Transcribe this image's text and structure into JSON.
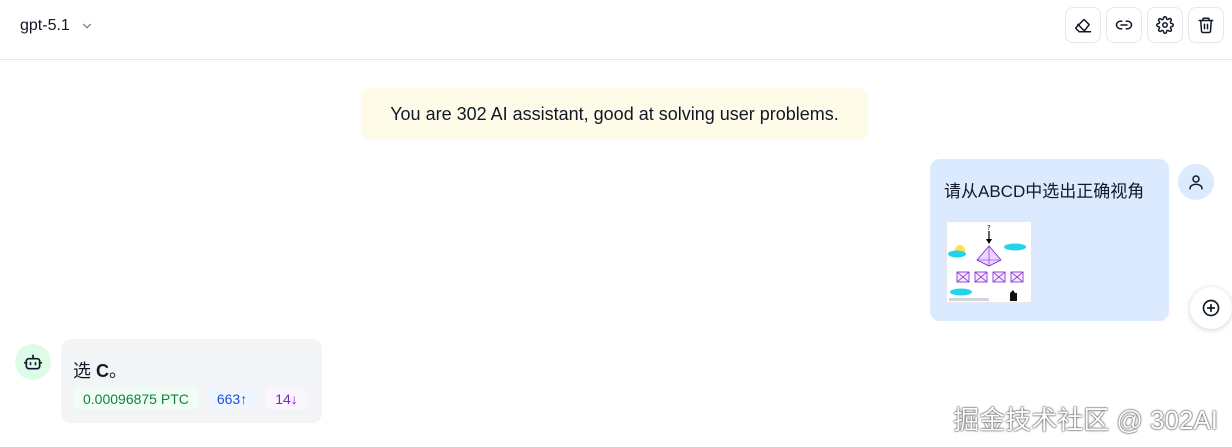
{
  "header": {
    "model_name": "gpt-5.1",
    "icons": {
      "model_chevron": "chevron-down-icon",
      "clear": "eraser-icon",
      "share": "link-icon",
      "settings": "gear-icon",
      "delete": "trash-icon"
    }
  },
  "chat": {
    "system_message": "You are 302 AI assistant, good at solving user problems.",
    "user_message": {
      "text": "请从ABCD中选出正确视角",
      "avatar_icon": "user-icon",
      "attachment_icon": "image-thumbnail"
    },
    "assistant_message": {
      "prefix": "选 ",
      "answer": "C",
      "suffix": "。",
      "avatar_icon": "robot-icon",
      "cost": "0.00096875 PTC",
      "input_tokens": "663",
      "input_arrow": "↑",
      "output_tokens": "14",
      "output_arrow": "↓"
    },
    "fab_icon": "plus-circle-icon"
  },
  "watermark": "掘金技术社区 @ 302AI",
  "colors": {
    "system_bg": "#fefce8",
    "user_bg": "#dbeafe",
    "assistant_bg": "#f3f4f6",
    "cost": "#15803d",
    "input": "#1d4ed8",
    "output": "#7e22ce"
  }
}
